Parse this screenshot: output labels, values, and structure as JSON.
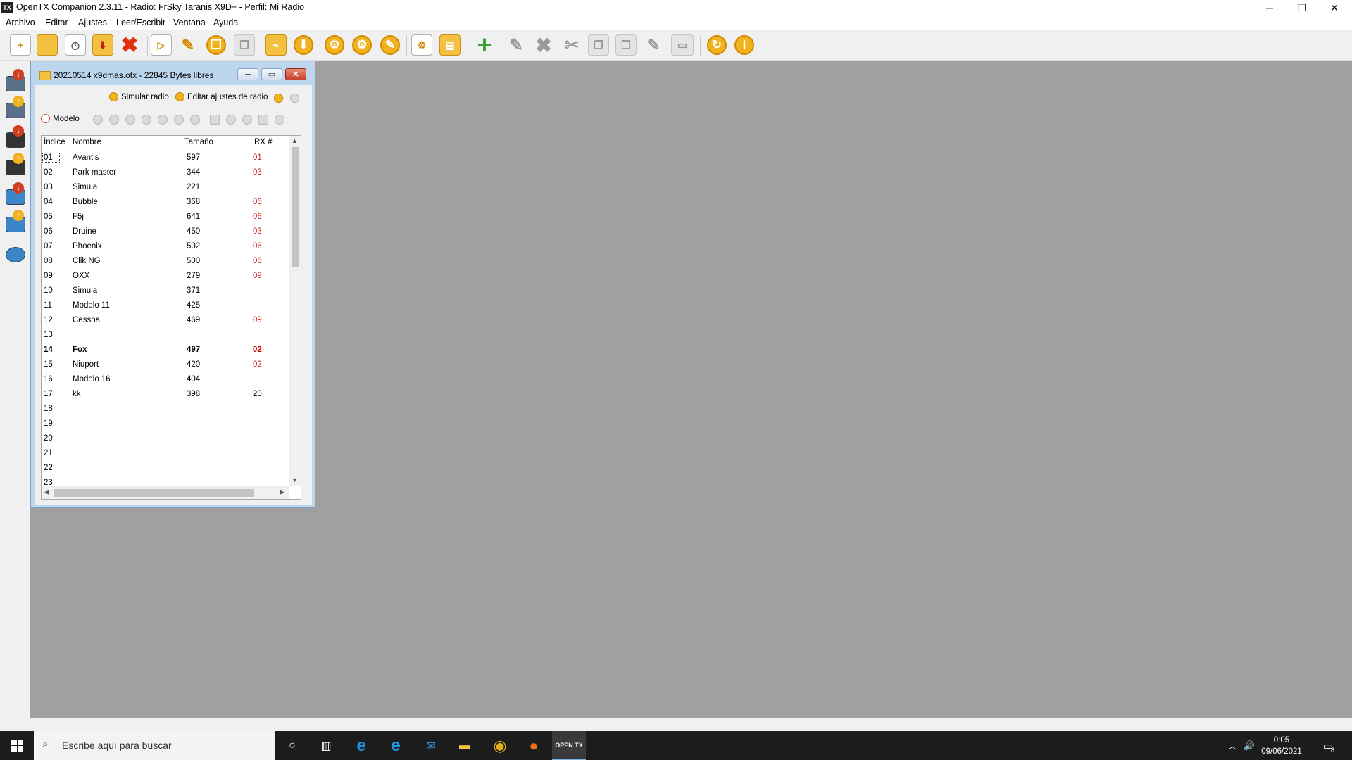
{
  "window": {
    "title": "OpenTX Companion 2.3.11 - Radio: FrSky Taranis X9D+ - Perfil: Mi Radio",
    "app_icon_text": "TX",
    "controls": {
      "minimize": "─",
      "restore": "❐",
      "close": "✕"
    }
  },
  "menu": [
    "Archivo",
    "Editar",
    "Ajustes",
    "Leer/Escribir",
    "Ventana",
    "Ayuda"
  ],
  "toolbar": {
    "icons": [
      "new-file-icon",
      "open-folder-icon",
      "recent-files-icon",
      "save-icon",
      "close-file-icon",
      "simulate-icon",
      "edit-icon",
      "copy-icon",
      "paste-icon",
      "compare-icon",
      "download-icon",
      "settings-icon",
      "radio-settings-icon",
      "edit-radio-icon",
      "logs-icon",
      "sd-card-icon",
      "add-model-icon",
      "edit-model-icon",
      "delete-model-icon",
      "cut-icon",
      "copy-model-icon",
      "paste-model-icon",
      "wizard-icon",
      "window-icon",
      "update-icon",
      "info-icon"
    ]
  },
  "child_window": {
    "title": "20210514 x9dmas.otx - 22845 Bytes libres",
    "actions": {
      "simulate": "Simular radio",
      "edit_settings": "Editar ajustes de radio"
    },
    "model_button": "Modelo",
    "columns": {
      "index": "Índice",
      "name": "Nombre",
      "size": "Tamaño",
      "rx": "RX #"
    },
    "rows": [
      {
        "idx": "01",
        "name": "Avantis",
        "size": "597",
        "rx": "01"
      },
      {
        "idx": "02",
        "name": "Park master",
        "size": "344",
        "rx": "03"
      },
      {
        "idx": "03",
        "name": "Simula",
        "size": "221",
        "rx": ""
      },
      {
        "idx": "04",
        "name": "Bubble",
        "size": "368",
        "rx": "06"
      },
      {
        "idx": "05",
        "name": "F5j",
        "size": "641",
        "rx": "06"
      },
      {
        "idx": "06",
        "name": "Druine",
        "size": "450",
        "rx": "03"
      },
      {
        "idx": "07",
        "name": "Phoenix",
        "size": "502",
        "rx": "06"
      },
      {
        "idx": "08",
        "name": "Clik NG",
        "size": "500",
        "rx": "06"
      },
      {
        "idx": "09",
        "name": "OXX",
        "size": "279",
        "rx": "09"
      },
      {
        "idx": "10",
        "name": "Simula",
        "size": "371",
        "rx": ""
      },
      {
        "idx": "11",
        "name": "Modelo 11",
        "size": "425",
        "rx": ""
      },
      {
        "idx": "12",
        "name": "Cessna",
        "size": "469",
        "rx": "09"
      },
      {
        "idx": "13",
        "name": "",
        "size": "",
        "rx": ""
      },
      {
        "idx": "14",
        "name": "Fox",
        "size": "497",
        "rx": "02"
      },
      {
        "idx": "15",
        "name": "Niuport",
        "size": "420",
        "rx": "02"
      },
      {
        "idx": "16",
        "name": "Modelo 16",
        "size": "404",
        "rx": ""
      },
      {
        "idx": "17",
        "name": "kk",
        "size": "398",
        "rx": "20"
      },
      {
        "idx": "18",
        "name": "",
        "size": "",
        "rx": ""
      },
      {
        "idx": "19",
        "name": "",
        "size": "",
        "rx": ""
      },
      {
        "idx": "20",
        "name": "",
        "size": "",
        "rx": ""
      },
      {
        "idx": "21",
        "name": "",
        "size": "",
        "rx": ""
      },
      {
        "idx": "22",
        "name": "",
        "size": "",
        "rx": ""
      },
      {
        "idx": "23",
        "name": "",
        "size": "",
        "rx": ""
      }
    ],
    "selected_row": "01",
    "bold_row": "14"
  },
  "taskbar": {
    "search_placeholder": "Escribe aquí para buscar",
    "time": "0:05",
    "date": "09/06/2021",
    "notification_count": "8",
    "opentx_label": "OPEN TX"
  },
  "colors": {
    "rx_red": "#d02020",
    "desktop": "#a0a0a0",
    "gold": "#f1b21e"
  }
}
